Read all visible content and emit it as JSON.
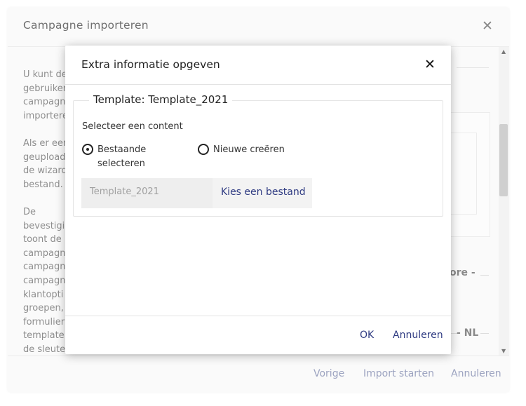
{
  "outer_dialog": {
    "title": "Campagne importeren",
    "body_text": "U kunt de\ngebruiken\ncampagn\nimportere\n\nAls er een\ngeupload\nde wizard\nbestand.\n\nDe\nbevestigi\ntoont de\ncampagn\ncampagn\ncampagn\nklantopti\ngroepen,\nformulier\ntemplate\nde sleute",
    "wizard_steps": [
      "ore -",
      "- NL"
    ],
    "footer": {
      "previous_label": "Vorige",
      "start_import_label": "Import starten",
      "cancel_label": "Annuleren"
    }
  },
  "modal": {
    "title": "Extra informatie opgeven",
    "fieldset_legend": "Template: Template_2021",
    "select_content_label": "Selecteer een content",
    "radio_existing": "Bestaande\nselecteren",
    "radio_new": "Nieuwe creëren",
    "selected_radio": "existing",
    "file_input_value": "Template_2021",
    "choose_file_label": "Kies een bestand",
    "ok_label": "OK",
    "cancel_label": "Annuleren"
  },
  "colors": {
    "accent": "#2f3b82",
    "muted_link": "#9ca3c0",
    "overlay_bg": "#fafafa"
  }
}
